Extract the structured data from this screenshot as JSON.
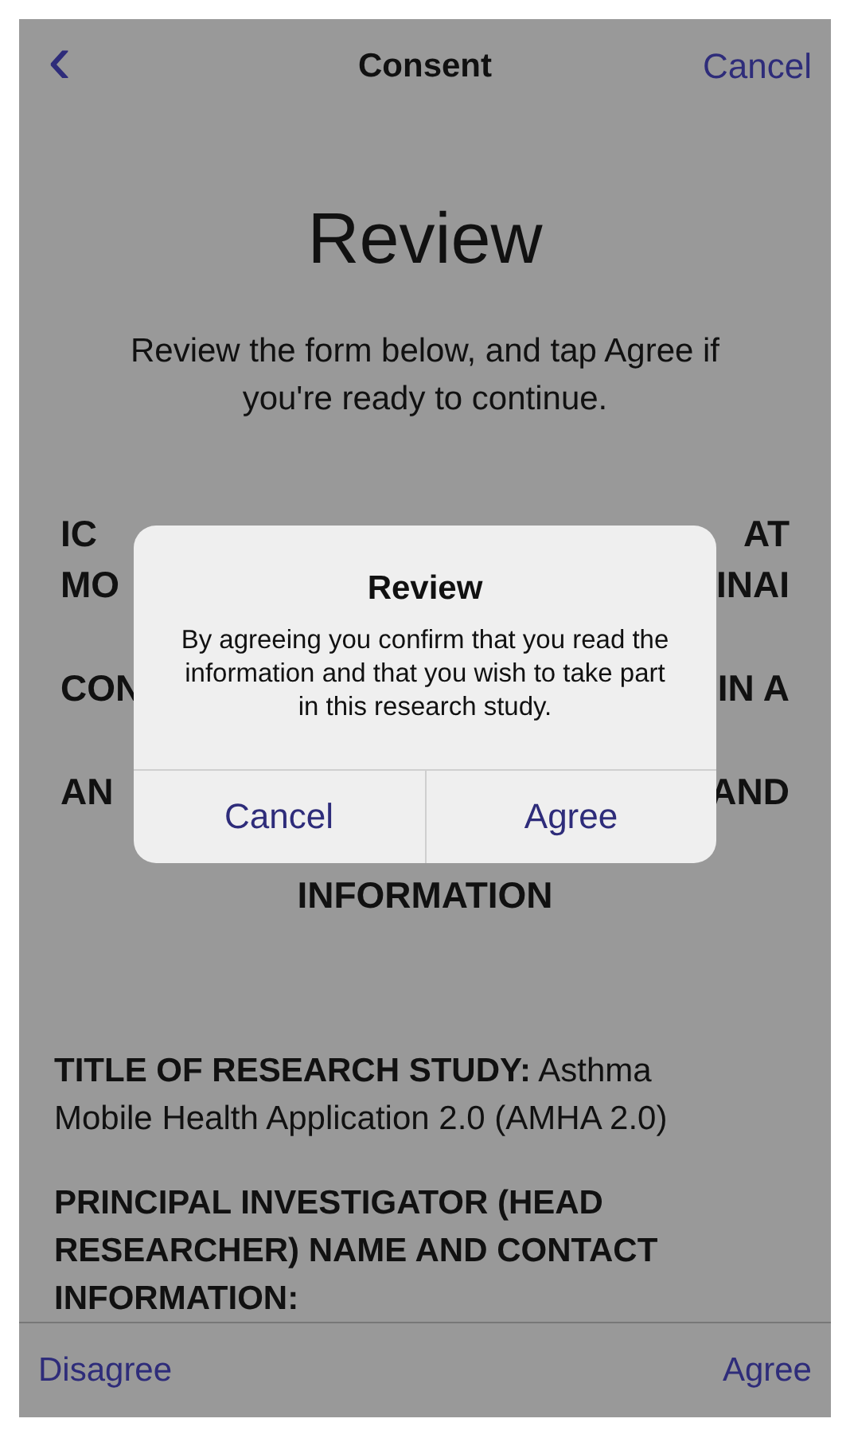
{
  "nav": {
    "back_icon": "‹",
    "title": "Consent",
    "cancel": "Cancel"
  },
  "title": "Review",
  "subtitle": "Review the form below, and tap Agree if you're ready to continue.",
  "heading_lines": [
    {
      "left": "IC",
      "right": "AT"
    },
    {
      "left": "MO",
      "right": "INAI"
    },
    {
      "left": "CON",
      "right": "IN A"
    },
    {
      "left": "AN",
      "right": "AND"
    },
    {
      "left": "INFORMATION"
    }
  ],
  "body": [
    "**TITLE OF RESEARCH STUDY:** Asthma Mobile Health Application 2.0 (AMHA 2.0)",
    "**PRINCIPAL INVESTIGATOR (HEAD RESEARCHER) NAME AND CONTACT INFORMATION:**"
  ],
  "toolbar": {
    "disagree": "Disagree",
    "agree": "Agree"
  },
  "alert": {
    "title": "Review",
    "message": "By agreeing you confirm that you read the information and that you wish to take part in this research study.",
    "buttons": [
      "Cancel",
      "Agree"
    ]
  }
}
